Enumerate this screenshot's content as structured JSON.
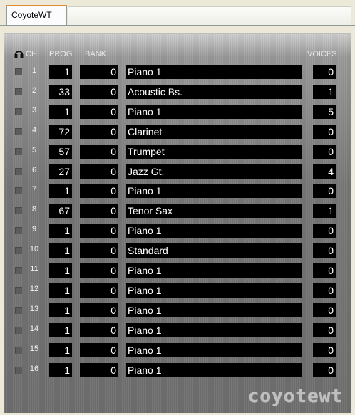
{
  "tab": {
    "active_label": "CoyoteWT"
  },
  "headers": {
    "ch": "CH",
    "prog": "PROG",
    "bank": "BANK",
    "voices": "VOICES"
  },
  "logo_text": "coyotewt",
  "colors": {
    "panel": "#787878",
    "cell_bg": "#000000",
    "tab_accent": "#e68b2c"
  },
  "channels": [
    {
      "ch": "1",
      "prog": "1",
      "bank": "0",
      "instrument": "Piano 1",
      "voices": "0"
    },
    {
      "ch": "2",
      "prog": "33",
      "bank": "0",
      "instrument": "Acoustic Bs.",
      "voices": "1"
    },
    {
      "ch": "3",
      "prog": "1",
      "bank": "0",
      "instrument": "Piano 1",
      "voices": "5"
    },
    {
      "ch": "4",
      "prog": "72",
      "bank": "0",
      "instrument": "Clarinet",
      "voices": "0"
    },
    {
      "ch": "5",
      "prog": "57",
      "bank": "0",
      "instrument": "Trumpet",
      "voices": "0"
    },
    {
      "ch": "6",
      "prog": "27",
      "bank": "0",
      "instrument": "Jazz Gt.",
      "voices": "4"
    },
    {
      "ch": "7",
      "prog": "1",
      "bank": "0",
      "instrument": "Piano 1",
      "voices": "0"
    },
    {
      "ch": "8",
      "prog": "67",
      "bank": "0",
      "instrument": "Tenor Sax",
      "voices": "1"
    },
    {
      "ch": "9",
      "prog": "1",
      "bank": "0",
      "instrument": "Piano 1",
      "voices": "0"
    },
    {
      "ch": "10",
      "prog": "1",
      "bank": "0",
      "instrument": "Standard",
      "voices": "0"
    },
    {
      "ch": "11",
      "prog": "1",
      "bank": "0",
      "instrument": "Piano 1",
      "voices": "0"
    },
    {
      "ch": "12",
      "prog": "1",
      "bank": "0",
      "instrument": "Piano 1",
      "voices": "0"
    },
    {
      "ch": "13",
      "prog": "1",
      "bank": "0",
      "instrument": "Piano 1",
      "voices": "0"
    },
    {
      "ch": "14",
      "prog": "1",
      "bank": "0",
      "instrument": "Piano 1",
      "voices": "0"
    },
    {
      "ch": "15",
      "prog": "1",
      "bank": "0",
      "instrument": "Piano 1",
      "voices": "0"
    },
    {
      "ch": "16",
      "prog": "1",
      "bank": "0",
      "instrument": "Piano 1",
      "voices": "0"
    }
  ]
}
